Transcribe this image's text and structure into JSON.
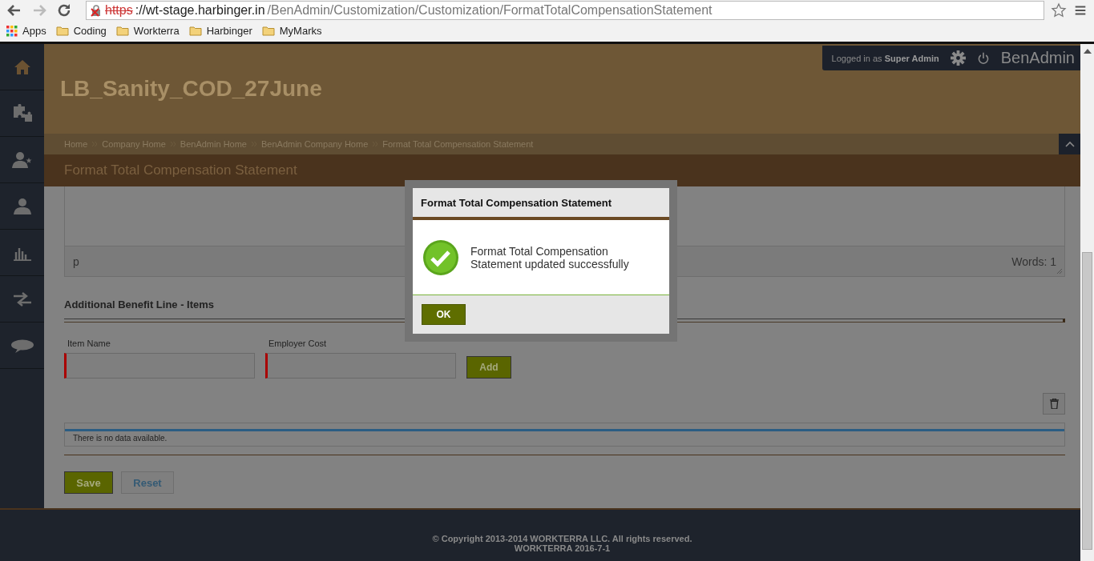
{
  "browser": {
    "url": {
      "scheme": "https",
      "host": "://wt-stage.harbinger.in",
      "path": "/BenAdmin/Customization/Customization/FormatTotalCompensationStatement"
    },
    "bookmarks": [
      {
        "label": "Apps",
        "kind": "apps"
      },
      {
        "label": "Coding",
        "kind": "folder"
      },
      {
        "label": "Workterra",
        "kind": "folder"
      },
      {
        "label": "Harbinger",
        "kind": "folder"
      },
      {
        "label": "MyMarks",
        "kind": "folder"
      }
    ]
  },
  "header": {
    "company": "LB_Sanity_COD_27June",
    "login": "Logged in as **Super Admin**",
    "app_name": "BenAdmin"
  },
  "breadcrumbs": [
    "Home",
    "Company Home",
    "BenAdmin Home",
    "BenAdmin Company Home",
    "Format Total Compensation Statement"
  ],
  "page_title": "Format Total Compensation Statement",
  "editor": {
    "path": "p",
    "word_count": "Words: 1"
  },
  "items_section": {
    "heading": "Additional Benefit Line - Items",
    "fields": [
      {
        "label": "Item Name",
        "required": true
      },
      {
        "label": "Employer Cost",
        "required": true
      }
    ],
    "add_button": "Add",
    "table_empty": "There is no data available."
  },
  "actions": {
    "save": "Save",
    "reset": "Reset"
  },
  "footer": {
    "copyright": "© Copyright 2013-2014 WORKTERRA LLC. All rights reserved.",
    "version": "WORKTERRA 2016-7-1"
  },
  "dialog": {
    "title": "Format Total Compensation Statement",
    "message": "Format Total Compensation Statement updated successfully",
    "ok": "OK"
  }
}
